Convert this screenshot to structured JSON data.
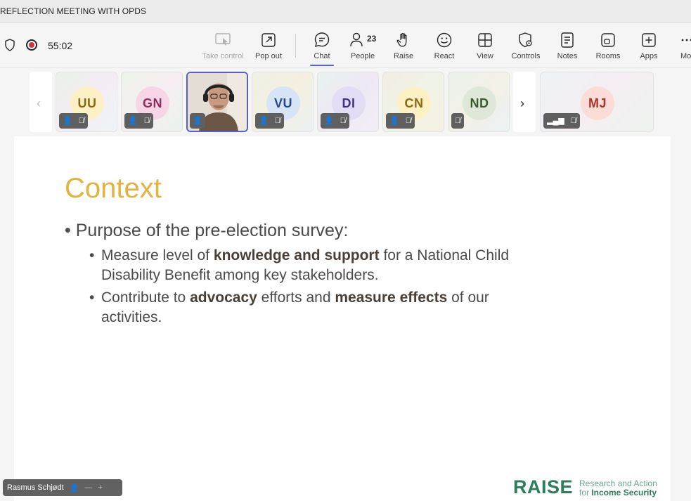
{
  "window": {
    "title": "REFLECTION MEETING WITH OPDS"
  },
  "toolbar": {
    "timer": "55:02",
    "buttons": [
      {
        "id": "take-control",
        "label": "Take control",
        "disabled": true
      },
      {
        "id": "pop-out",
        "label": "Pop out"
      },
      {
        "id": "chat",
        "label": "Chat",
        "active": true
      },
      {
        "id": "people",
        "label": "People",
        "count": "23"
      },
      {
        "id": "raise",
        "label": "Raise"
      },
      {
        "id": "react",
        "label": "React"
      },
      {
        "id": "view",
        "label": "View"
      },
      {
        "id": "controls",
        "label": "Controls"
      },
      {
        "id": "notes",
        "label": "Notes"
      },
      {
        "id": "rooms",
        "label": "Rooms"
      },
      {
        "id": "apps",
        "label": "Apps"
      },
      {
        "id": "more",
        "label": "Mo"
      }
    ]
  },
  "participants": [
    {
      "initials": "UU",
      "bg": "#fdf0c4",
      "fg": "#8a6a10"
    },
    {
      "initials": "GN",
      "bg": "#f6d6e6",
      "fg": "#8e2d5a"
    },
    {
      "initials": "",
      "video": true
    },
    {
      "initials": "VU",
      "bg": "#d6e4f5",
      "fg": "#244a8a"
    },
    {
      "initials": "DI",
      "bg": "#e2dcf4",
      "fg": "#3e3486"
    },
    {
      "initials": "CN",
      "bg": "#fdf0c4",
      "fg": "#8a6a10"
    },
    {
      "initials": "ND",
      "bg": "#dfe8d8",
      "fg": "#3a5a2e"
    },
    {
      "initials": "MJ",
      "bg": "#fbdcd6",
      "fg": "#a4372a"
    }
  ],
  "slide": {
    "heading": "Context",
    "bullet1": "Purpose of the pre-election survey:",
    "sub1": {
      "pre": "Measure level of ",
      "bold": "knowledge and support",
      "post": " for a National Child Disability Benefit among key stakeholders."
    },
    "sub2": {
      "pre": "Contribute to ",
      "bold1": "advocacy",
      "mid": " efforts and ",
      "bold2": "measure effects",
      "post": " of our activities."
    },
    "logo": {
      "name": "RAISE",
      "line1": "Research and Action",
      "line2_pre": "for ",
      "line2_bold": "Income Security"
    }
  },
  "nametag": {
    "name": "Rasmus Schjødt"
  }
}
